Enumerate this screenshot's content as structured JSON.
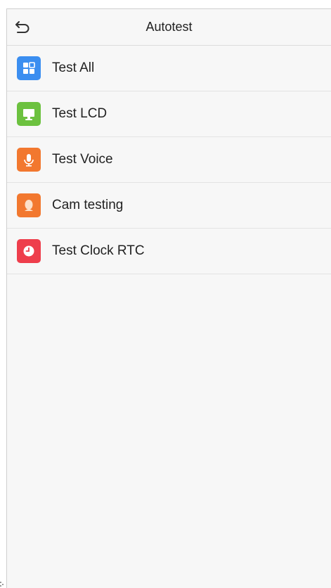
{
  "header": {
    "title": "Autotest",
    "back_icon": "back-arrow-icon"
  },
  "menu": {
    "items": [
      {
        "label": "Test All",
        "icon": "grid-icon",
        "color": "#3b8ef0"
      },
      {
        "label": "Test LCD",
        "icon": "monitor-icon",
        "color": "#6cc13f"
      },
      {
        "label": "Test Voice",
        "icon": "microphone-icon",
        "color": "#f2782f"
      },
      {
        "label": "Cam testing",
        "icon": "camera-face-icon",
        "color": "#f2782f"
      },
      {
        "label": "Test Clock RTC",
        "icon": "clock-icon",
        "color": "#ee3e4c"
      }
    ]
  }
}
